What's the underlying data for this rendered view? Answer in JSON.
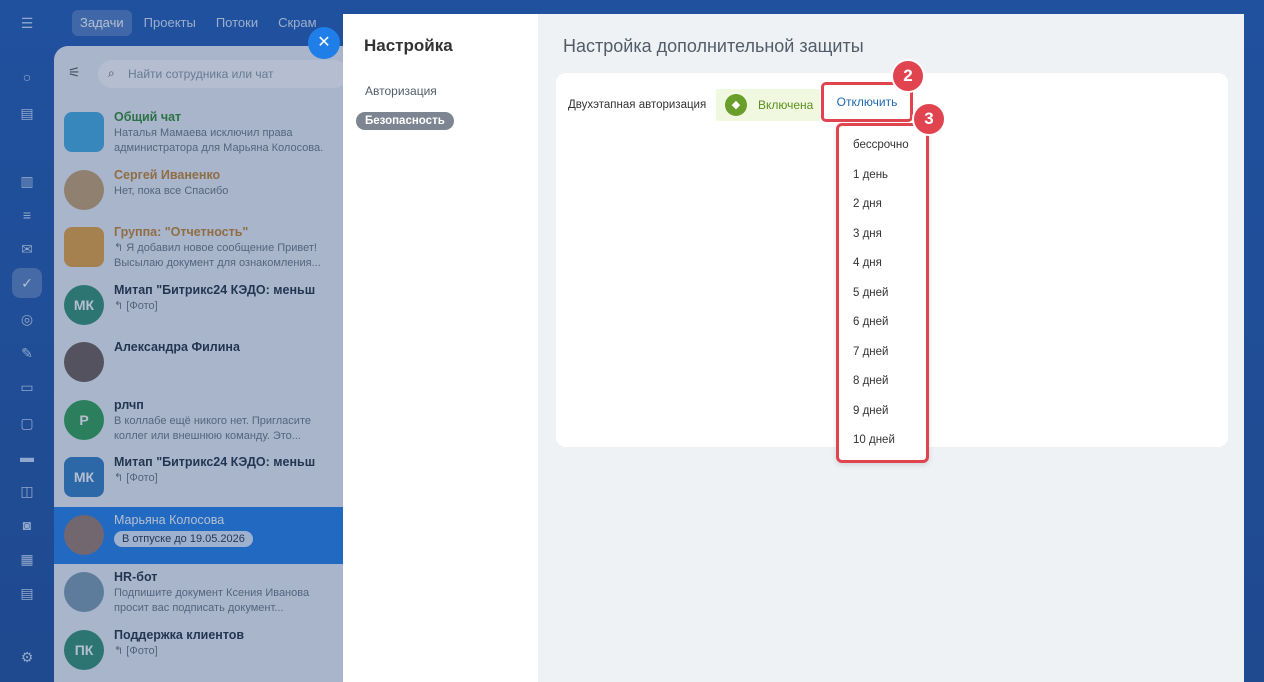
{
  "top_tabs": [
    "Задачи",
    "Проекты",
    "Потоки",
    "Скрам"
  ],
  "chat": {
    "search_placeholder": "Найти сотрудника или чат",
    "items": [
      {
        "name": "Общий чат",
        "text": "Наталья Мамаева исключил права",
        "text2": "администратора для Марьяна Колосова.",
        "color": "#3fa9e0",
        "initials": ""
      },
      {
        "name": "Сергей Иваненко",
        "text": "Нет, пока все Спасибо",
        "text2": "",
        "color": "#c7a06a",
        "initials": ""
      },
      {
        "name": "Группа: \"Отчетность\"",
        "text": "↰ Я добавил новое сообщение Привет!",
        "text2": "Высылаю документ для ознакомления...",
        "color": "#e9a23b",
        "initials": ""
      },
      {
        "name": "Митап \"Битрикс24 КЭДО: меньш",
        "text": "↰ [Фото]",
        "text2": "",
        "color": "#2f8f6f",
        "initials": "МК"
      },
      {
        "name": "Александра Филина",
        "text": "",
        "text2": "",
        "color": "#6a5a50",
        "initials": ""
      },
      {
        "name": "рлчп",
        "text": "В коллабе ещё никого нет. Пригласите",
        "text2": "коллег или внешнюю команду. Это...",
        "color": "#2f9f4f",
        "initials": "Р"
      },
      {
        "name": "Митап \"Битрикс24 КЭДО: меньш",
        "text": "↰ [Фото]",
        "text2": "",
        "color": "#2f7ac0",
        "initials": "МК"
      },
      {
        "name": "Марьяна Колосова",
        "text": "",
        "text2": "",
        "color": "#9a7a6a",
        "initials": "",
        "badge": "В отпуске до 19.05.2026"
      },
      {
        "name": "HR-бот",
        "text": "Подпишите документ Ксения Иванова",
        "text2": "просит вас подписать документ...",
        "color": "#7a9ab0",
        "initials": ""
      },
      {
        "name": "Поддержка клиентов",
        "text": "↰ [Фото]",
        "text2": "",
        "color": "#2f8f6f",
        "initials": "ПК"
      }
    ]
  },
  "settings": {
    "title": "Настройка",
    "nav": [
      {
        "label": "Авторизация"
      },
      {
        "label": "Безопасность"
      }
    ],
    "page_title": "Настройка дополнительной защиты",
    "row_label": "Двухэтапная авторизация",
    "status": "Включена",
    "disable_button": "Отключить",
    "dropdown_options": [
      "бессрочно",
      "1 день",
      "2 дня",
      "3 дня",
      "4 дня",
      "5 дней",
      "6 дней",
      "7 дней",
      "8 дней",
      "9 дней",
      "10 дней"
    ],
    "markers": [
      "2",
      "3"
    ]
  }
}
